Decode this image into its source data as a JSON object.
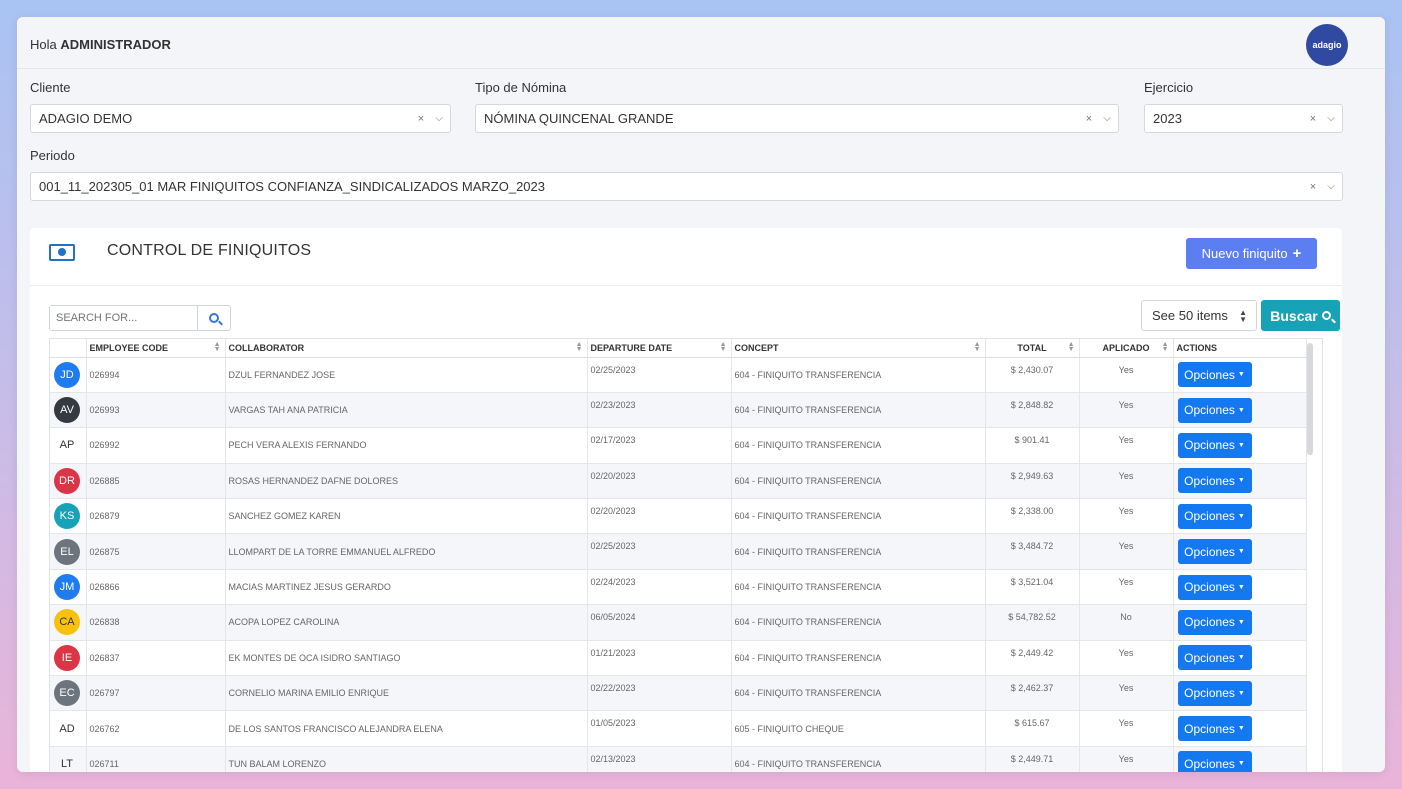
{
  "header": {
    "greeting_prefix": "Hola",
    "user_name": "ADMINISTRADOR",
    "logo_text": "adagio"
  },
  "filters": {
    "cliente": {
      "label": "Cliente",
      "value": "ADAGIO DEMO"
    },
    "tipo_nomina": {
      "label": "Tipo de Nómina",
      "value": "NÓMINA QUINCENAL GRANDE"
    },
    "ejercicio": {
      "label": "Ejercicio",
      "value": "2023"
    },
    "periodo": {
      "label": "Periodo",
      "value": "001_11_202305_01 MAR FINIQUITOS CONFIANZA_SINDICALIZADOS MARZO_2023"
    },
    "clear_glyph": "×",
    "caret_glyph": "⌵"
  },
  "card": {
    "title": "CONTROL DE FINIQUITOS",
    "new_button": "Nuevo finiquito",
    "new_button_icon": "+",
    "search_placeholder": "SEARCH FOR...",
    "page_size_label": "See 50 items",
    "search_button": "Buscar"
  },
  "table": {
    "columns": {
      "employee_code": "EMPLOYEE CODE",
      "collaborator": "COLLABORATOR",
      "departure_date": "DEPARTURE DATE",
      "concept": "CONCEPT",
      "total": "TOTAL",
      "aplicado": "APLICADO",
      "actions": "ACTIONS"
    },
    "action_label": "Opciones",
    "rows": [
      {
        "initials": "JD",
        "color": "#1e7cf0",
        "code": "026994",
        "name": "DZUL FERNANDEZ JOSE",
        "date": "02/25/2023",
        "concept": "604 - FINIQUITO TRANSFERENCIA",
        "total": "$ 2,430.07",
        "aplicado": "Yes"
      },
      {
        "initials": "AV",
        "color": "#343a40",
        "code": "026993",
        "name": "VARGAS TAH ANA PATRICIA",
        "date": "02/23/2023",
        "concept": "604 - FINIQUITO TRANSFERENCIA",
        "total": "$ 2,848.82",
        "aplicado": "Yes"
      },
      {
        "initials": "AP",
        "color": "",
        "code": "026992",
        "name": "PECH VERA ALEXIS FERNANDO",
        "date": "02/17/2023",
        "concept": "604 - FINIQUITO TRANSFERENCIA",
        "total": "$ 901.41",
        "aplicado": "Yes"
      },
      {
        "initials": "DR",
        "color": "#dc3545",
        "code": "026885",
        "name": "ROSAS HERNANDEZ DAFNE DOLORES",
        "date": "02/20/2023",
        "concept": "604 - FINIQUITO TRANSFERENCIA",
        "total": "$ 2,949.63",
        "aplicado": "Yes"
      },
      {
        "initials": "KS",
        "color": "#17a2b8",
        "code": "026879",
        "name": "SANCHEZ GOMEZ KAREN",
        "date": "02/20/2023",
        "concept": "604 - FINIQUITO TRANSFERENCIA",
        "total": "$ 2,338.00",
        "aplicado": "Yes"
      },
      {
        "initials": "EL",
        "color": "#6c757d",
        "code": "026875",
        "name": "LLOMPART DE LA TORRE EMMANUEL ALFREDO",
        "date": "02/25/2023",
        "concept": "604 - FINIQUITO TRANSFERENCIA",
        "total": "$ 3,484.72",
        "aplicado": "Yes"
      },
      {
        "initials": "JM",
        "color": "#1e7cf0",
        "code": "026866",
        "name": "MACIAS MARTINEZ JESUS GERARDO",
        "date": "02/24/2023",
        "concept": "604 - FINIQUITO TRANSFERENCIA",
        "total": "$ 3,521.04",
        "aplicado": "Yes"
      },
      {
        "initials": "CA",
        "color": "#f6c20e",
        "code": "026838",
        "name": "ACOPA LOPEZ CAROLINA",
        "date": "06/05/2024",
        "concept": "604 - FINIQUITO TRANSFERENCIA",
        "total": "$ 54,782.52",
        "aplicado": "No"
      },
      {
        "initials": "IE",
        "color": "#dc3545",
        "code": "026837",
        "name": "EK MONTES DE OCA ISIDRO SANTIAGO",
        "date": "01/21/2023",
        "concept": "604 - FINIQUITO TRANSFERENCIA",
        "total": "$ 2,449.42",
        "aplicado": "Yes"
      },
      {
        "initials": "EC",
        "color": "#6c757d",
        "code": "026797",
        "name": "CORNELIO MARINA EMILIO ENRIQUE",
        "date": "02/22/2023",
        "concept": "604 - FINIQUITO TRANSFERENCIA",
        "total": "$ 2,462.37",
        "aplicado": "Yes"
      },
      {
        "initials": "AD",
        "color": "",
        "code": "026762",
        "name": "DE LOS SANTOS FRANCISCO ALEJANDRA ELENA",
        "date": "01/05/2023",
        "concept": "605 - FINIQUITO CHEQUE",
        "total": "$ 615.67",
        "aplicado": "Yes"
      },
      {
        "initials": "LT",
        "color": "",
        "code": "026711",
        "name": "TUN BALAM LORENZO",
        "date": "02/13/2023",
        "concept": "604 - FINIQUITO TRANSFERENCIA",
        "total": "$ 2,449.71",
        "aplicado": "Yes"
      }
    ]
  }
}
